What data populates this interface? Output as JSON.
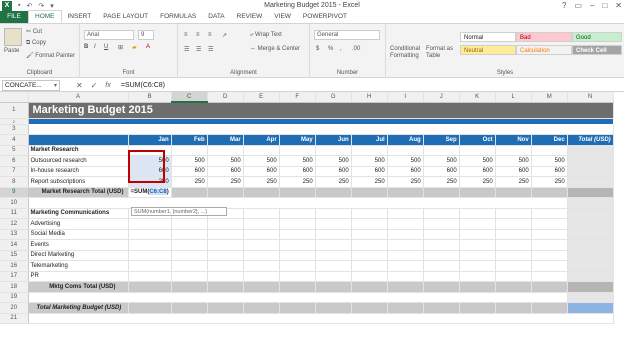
{
  "window": {
    "title": "Marketing Budget 2015 - Excel",
    "app_icon": "X"
  },
  "ribbon_tabs": [
    {
      "label": "FILE"
    },
    {
      "label": "HOME"
    },
    {
      "label": "INSERT"
    },
    {
      "label": "PAGE LAYOUT"
    },
    {
      "label": "FORMULAS"
    },
    {
      "label": "DATA"
    },
    {
      "label": "REVIEW"
    },
    {
      "label": "VIEW"
    },
    {
      "label": "POWERPIVOT"
    }
  ],
  "clipboard": {
    "paste": "Paste",
    "cut": "Cut",
    "copy": "Copy",
    "format_painter": "Format Painter",
    "label": "Clipboard"
  },
  "font": {
    "name": "Arial",
    "size": "9",
    "label": "Font"
  },
  "alignment": {
    "wrap": "Wrap Text",
    "merge": "Merge & Center",
    "label": "Alignment"
  },
  "number": {
    "format": "General",
    "label": "Number"
  },
  "styles": {
    "conditional": "Conditional Formatting",
    "format_as_table": "Format as Table",
    "normal": "Normal",
    "bad": "Bad",
    "good": "Good",
    "neutral": "Neutral",
    "calculation": "Calculation",
    "check_cell": "Check Cell",
    "label": "Styles"
  },
  "formula_bar": {
    "name_box": "CONCATE...",
    "formula": "=SUM(C6:C8)",
    "fx": "fx"
  },
  "columns": [
    "A",
    "B",
    "C",
    "D",
    "E",
    "F",
    "G",
    "H",
    "I",
    "J",
    "K",
    "L",
    "M",
    "N",
    "O"
  ],
  "sheet": {
    "title": "Marketing Budget 2015",
    "months": [
      "Jan",
      "Feb",
      "Mar",
      "Apr",
      "May",
      "Jun",
      "Jul",
      "Aug",
      "Sep",
      "Oct",
      "Nov",
      "Dec"
    ],
    "total_header": "Total (USD)",
    "section1": "Market Research",
    "rows1": [
      {
        "label": "Outsourced research",
        "values": [
          "500",
          "500",
          "500",
          "500",
          "500",
          "500",
          "500",
          "500",
          "500",
          "500",
          "500",
          "500"
        ]
      },
      {
        "label": "In-house research",
        "values": [
          "600",
          "600",
          "600",
          "600",
          "600",
          "600",
          "600",
          "600",
          "600",
          "600",
          "600",
          "600"
        ]
      },
      {
        "label": "Report subscriptions",
        "values": [
          "250",
          "250",
          "250",
          "250",
          "250",
          "250",
          "250",
          "250",
          "250",
          "250",
          "250",
          "250"
        ]
      }
    ],
    "mr_total_label": "Market Research Total (USD)",
    "formula_prefix": "=SUM(",
    "formula_ref": "C6:C8",
    "formula_suffix": ")",
    "tooltip": "SUM(number1, [number2], ...)",
    "section2": "Marketing Communications",
    "rows2": [
      "Advertising",
      "Social Media",
      "Events",
      "Direct Marketing",
      "Telemarketing",
      "PR"
    ],
    "mc_total_label": "Mktg Coms Total (USD)",
    "total_label": "Total Marketing Budget (USD)"
  }
}
